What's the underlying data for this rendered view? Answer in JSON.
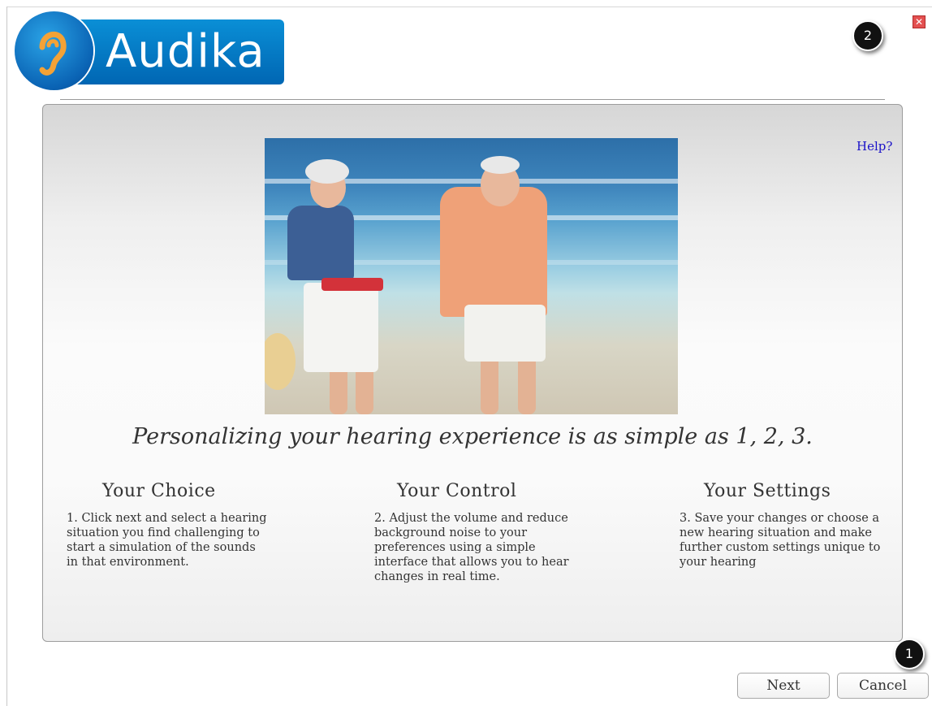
{
  "brand": {
    "name": "Audika"
  },
  "window": {
    "close_glyph": "✕"
  },
  "badges": {
    "top": "2",
    "bottom": "1"
  },
  "help": {
    "label": "Help?"
  },
  "hero": {
    "image_subject": "elderly couple holding hands walking on a beach"
  },
  "headline": "Personalizing your hearing experience is as simple as 1, 2, 3.",
  "steps": [
    {
      "title": "Your Choice",
      "text": "1. Click next and select a hearing situation you find challenging to start a simulation of the sounds in that environment."
    },
    {
      "title": "Your Control",
      "text": "2. Adjust the volume and reduce background noise to your preferences using a simple interface that allows you to hear changes in real time."
    },
    {
      "title": "Your Settings",
      "text": "3. Save your changes or choose a new hearing situation and make further custom settings unique to your hearing"
    }
  ],
  "buttons": {
    "next": "Next",
    "cancel": "Cancel"
  },
  "colors": {
    "brand_blue": "#0a7cc8",
    "link": "#1a12c8",
    "close_red": "#e35050"
  }
}
